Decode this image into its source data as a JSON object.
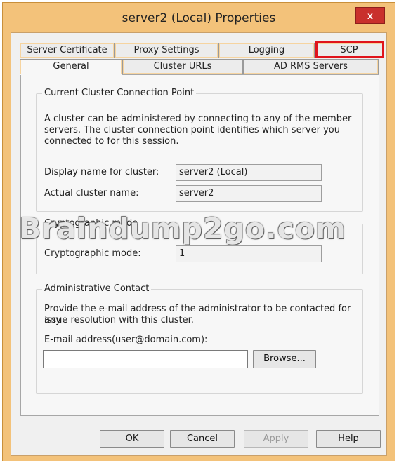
{
  "window": {
    "title": "server2 (Local) Properties",
    "close_label": "x"
  },
  "tabs": {
    "row1": [
      "Server Certificate",
      "Proxy Settings",
      "Logging",
      "SCP"
    ],
    "row2": [
      "General",
      "Cluster URLs",
      "AD RMS Servers"
    ],
    "active": "General",
    "highlighted": "SCP",
    "highlight_color": "#e0141c"
  },
  "scp_group": {
    "legend": "Current Cluster Connection Point",
    "description": [
      "A cluster can be administered by connecting to any of the member",
      "servers. The cluster connection point identifies which server you",
      "connected to for this session."
    ],
    "display_name_label": "Display name for cluster:",
    "display_name_value": "server2 (Local)",
    "actual_name_label": "Actual cluster name:",
    "actual_name_value": "server2"
  },
  "crypto_group": {
    "legend": "Cryptographic mode",
    "mode_label": "Cryptographic mode:",
    "mode_value": "1"
  },
  "admin_group": {
    "legend": "Administrative Contact",
    "description": [
      "Provide the e-mail address of the administrator to be contacted for any",
      "issue resolution with this cluster."
    ],
    "email_label": "E-mail address(user@domain.com):",
    "email_value": "",
    "browse_label": "Browse..."
  },
  "buttons": {
    "ok": "OK",
    "cancel": "Cancel",
    "apply": "Apply",
    "help": "Help"
  },
  "watermark": "Braindump2go.com"
}
